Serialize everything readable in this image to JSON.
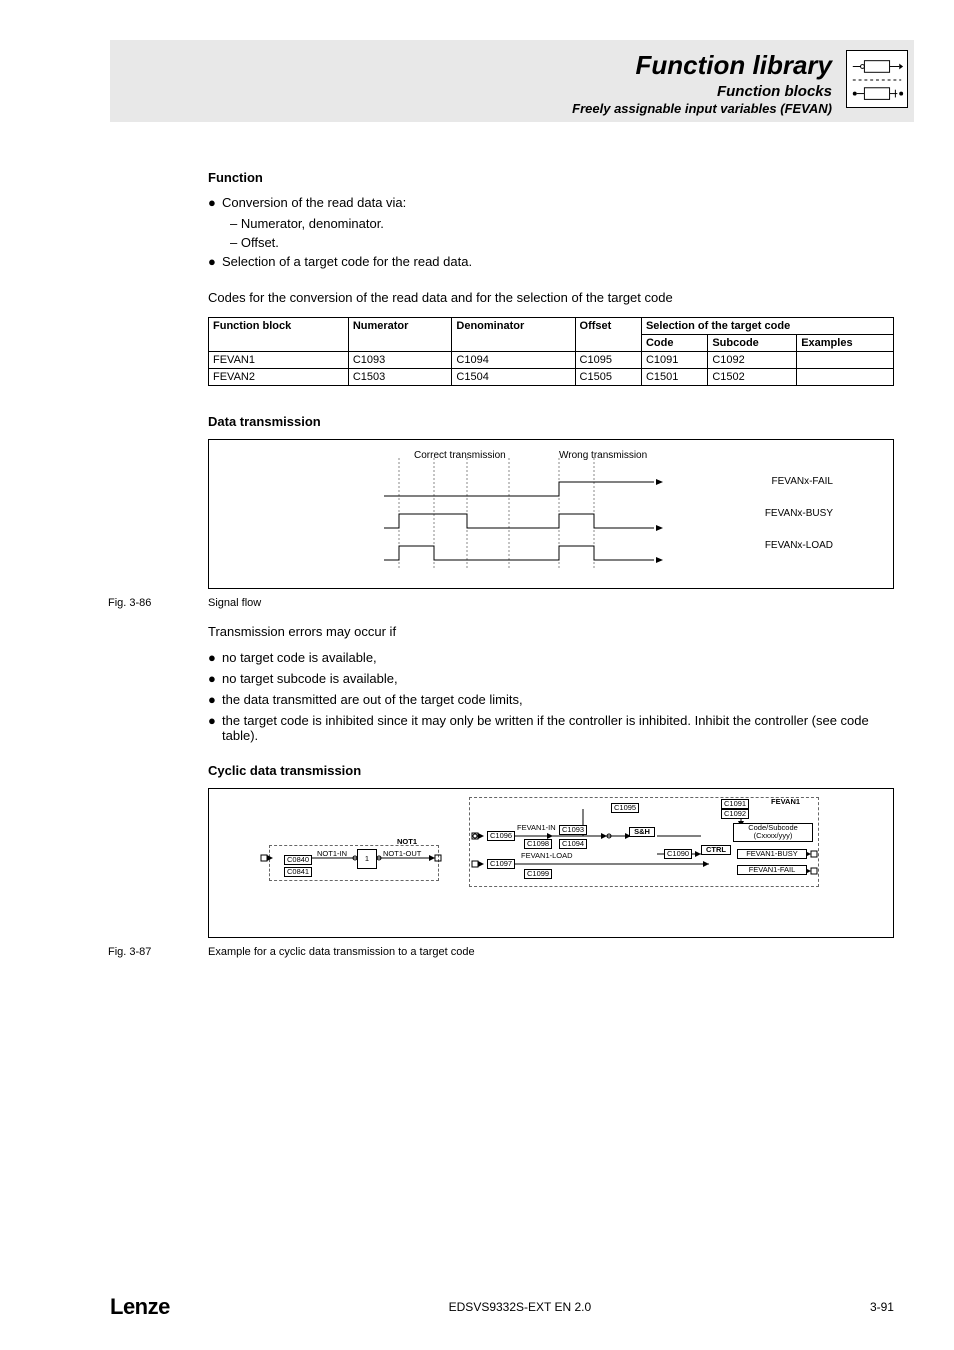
{
  "header": {
    "title": "Function library",
    "sub1": "Function blocks",
    "sub2": "Freely assignable input variables (FEVAN)"
  },
  "sec_function_h": "Function",
  "func_b1": "Conversion of the read data via:",
  "func_s1": "– Numerator, denominator.",
  "func_s2": "– Offset.",
  "func_b2": "Selection of a target code for the read data.",
  "codes_intro": "Codes for the conversion of the read data and for the selection of the target code",
  "table": {
    "super": "Selection of the target code",
    "h_fb": "Function block",
    "h_num": "Numerator",
    "h_den": "Denominator",
    "h_off": "Offset",
    "h_code": "Code",
    "h_sub": "Subcode",
    "h_ex": "Examples",
    "rows": [
      {
        "fb": "FEVAN1",
        "num": "C1093",
        "den": "C1094",
        "off": "C1095",
        "code": "C1091",
        "sub": "C1092",
        "ex": ""
      },
      {
        "fb": "FEVAN2",
        "num": "C1503",
        "den": "C1504",
        "off": "C1505",
        "code": "C1501",
        "sub": "C1502",
        "ex": ""
      }
    ]
  },
  "sec_data_h": "Data transmission",
  "timing": {
    "l1": "Correct transmission",
    "l2": "Wrong transmission",
    "s1": "FEVANx-FAIL",
    "s2": "FEVANx-BUSY",
    "s3": "FEVANx-LOAD"
  },
  "fig86_no": "Fig. 3-86",
  "fig86_cap": "Signal flow",
  "trans_intro": "Transmission errors may occur if",
  "tb1": "no target code is available,",
  "tb2": "no target subcode is available,",
  "tb3": "the data transmitted are out of the target code limits,",
  "tb4": "the target code is inhibited since it may only be written if the controller is inhibited. Inhibit the controller (see code table).",
  "sec_cyclic_h": "Cyclic data transmission",
  "d2": {
    "not1": "NOT1",
    "not1_in": "NOT1-IN",
    "not1_out": "NOT1-OUT",
    "c0840": "C0840",
    "c0841": "C0841",
    "one": "1",
    "fevan1": "FEVAN1",
    "fevan1_in": "FEVAN1-IN",
    "fevan1_load": "FEVAN1-LOAD",
    "c1096": "C1096",
    "c1097": "C1097",
    "c1098": "C1098",
    "c1099": "C1099",
    "c1093": "C1093",
    "c1094": "C1094",
    "c1095": "C1095",
    "c1091": "C1091",
    "c1092": "C1092",
    "c1090": "C1090",
    "sh": "S&H",
    "ctrl": "CTRL",
    "codesub": "Code/Subcode",
    "cxy": "(Cxxxx/yyy)",
    "busy": "FEVAN1-BUSY",
    "fail": "FEVAN1-FAIL"
  },
  "fig87_no": "Fig. 3-87",
  "fig87_cap": "Example for a cyclic data transmission to a target code",
  "footer": {
    "brand": "Lenze",
    "doc": "EDSVS9332S-EXT EN 2.0",
    "page": "3-91"
  }
}
